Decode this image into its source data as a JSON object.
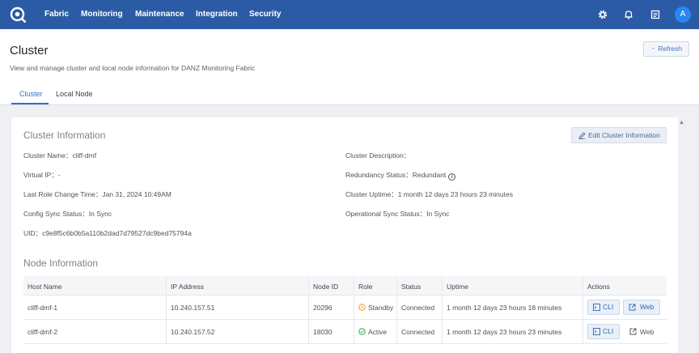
{
  "nav": {
    "items": [
      "Fabric",
      "Monitoring",
      "Maintenance",
      "Integration",
      "Security"
    ],
    "avatar_initial": "A"
  },
  "page": {
    "title": "Cluster",
    "subtitle": "View and manage cluster and local node information for DANZ Monitoring Fabric",
    "refresh_label": "Refresh",
    "tabs": [
      "Cluster",
      "Local Node"
    ]
  },
  "cluster_info": {
    "heading": "Cluster Information",
    "edit_label": "Edit Cluster Information",
    "left": [
      {
        "label": "Cluster Name：",
        "value": "cliff-dmf"
      },
      {
        "label": "Virtual IP：",
        "value": "-"
      },
      {
        "label": "Last Role Change Time：",
        "value": "Jan 31, 2024 10:49AM"
      },
      {
        "label": "Config Sync Status：",
        "value": "In Sync"
      },
      {
        "label": "UID：",
        "value": "c9e8f5c6b0b5a110b2dad7d79527dc9bed75794a"
      }
    ],
    "right": [
      {
        "label": "Cluster Description：",
        "value": ""
      },
      {
        "label": "Redundancy Status：",
        "value": "Redundant"
      },
      {
        "label": "Cluster Uptime：",
        "value": "1 month 12 days 23 hours 23 minutes"
      },
      {
        "label": "Operational Sync Status：",
        "value": "In Sync"
      }
    ]
  },
  "node_info": {
    "heading": "Node Information",
    "columns": [
      "Host Name",
      "IP Address",
      "Node ID",
      "Role",
      "Status",
      "Uptime",
      "Actions"
    ],
    "rows": [
      {
        "host": "cliff-dmf-1",
        "ip": "10.240.157.51",
        "node_id": "20296",
        "role": "Standby",
        "status": "Connected",
        "uptime": "1 month 12 days 23 hours 18 minutes",
        "cli": "CLI",
        "web": "Web"
      },
      {
        "host": "cliff-dmf-2",
        "ip": "10.240.157.52",
        "node_id": "18030",
        "role": "Active",
        "status": "Connected",
        "uptime": "1 month 12 days 23 hours 23 minutes",
        "cli": "CLI",
        "web": "Web"
      }
    ]
  },
  "colors": {
    "topbar": "#2c5ba5",
    "accent": "#2f6fc9",
    "standby": "#e7a02f",
    "active": "#3aa657"
  }
}
